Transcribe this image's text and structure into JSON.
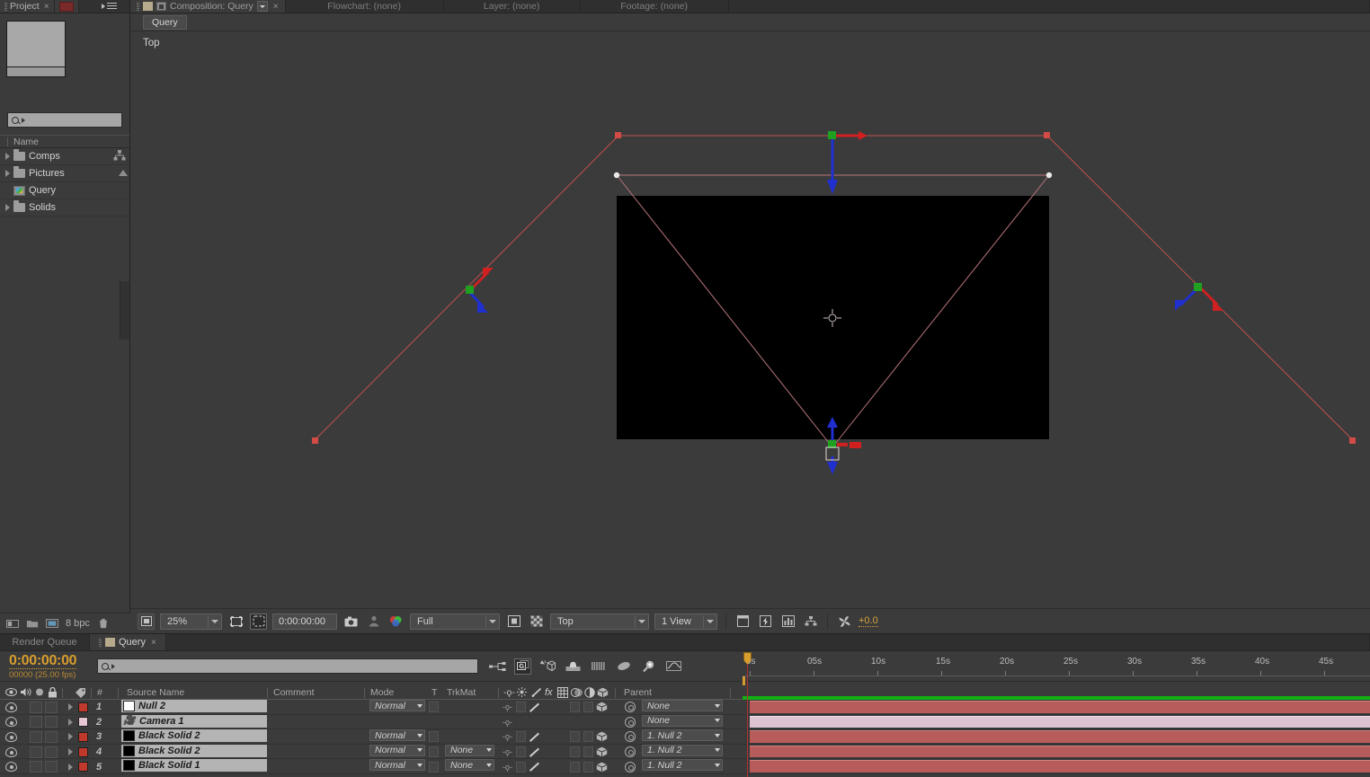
{
  "project": {
    "tab_label": "Project",
    "close_glyph": "×",
    "search_placeholder": "",
    "search_value": "",
    "column_header": "Name",
    "items": [
      {
        "label": "Comps",
        "icon": "folder-icon",
        "has_disclosure": true
      },
      {
        "label": "Pictures",
        "icon": "folder-icon",
        "has_disclosure": true
      },
      {
        "label": "Query",
        "icon": "composition-icon",
        "has_disclosure": false
      },
      {
        "label": "Solids",
        "icon": "folder-icon",
        "has_disclosure": true
      }
    ],
    "footer": {
      "bit_depth": "8 bpc",
      "icons": [
        "new-comp-icon",
        "new-folder-icon",
        "new-footage-icon",
        "delete-icon"
      ]
    }
  },
  "comp_panel": {
    "tabs": [
      {
        "label": "Composition: Query",
        "active": true
      },
      {
        "label": "Flowchart: (none)",
        "active": false
      },
      {
        "label": "Layer: (none)",
        "active": false
      },
      {
        "label": "Footage: (none)",
        "active": false
      }
    ],
    "sub_tab": "Query",
    "view_label": "Top",
    "toolbar": {
      "magnification": "25%",
      "timecode": "0:00:00:00",
      "resolution": "Full",
      "view_layout_3d": "Top",
      "views": "1 View",
      "exposure": "+0.0",
      "icons": [
        "always-preview-icon",
        "region-of-interest-icon",
        "toggle-mask-paths-icon",
        "snapshot-icon",
        "show-snapshot-icon",
        "channel-icon",
        "toggle-transparency-grid-icon",
        "toggle-pixel-aspect-icon",
        "timeline-icon",
        "fast-previews-icon",
        "comp-flowchart-icon",
        "reset-exposure-icon"
      ]
    }
  },
  "timeline": {
    "tabs": [
      {
        "label": "Render Queue",
        "active": false
      },
      {
        "label": "Query",
        "active": true,
        "close_glyph": "×"
      }
    ],
    "current_time": "0:00:00:00",
    "frame_info": "00000 (25.00 fps)",
    "search_value": "",
    "tools": [
      "composition-mini-flowchart-icon",
      "draft-3d-icon",
      "hide-shy-layers-icon",
      "frame-blending-icon",
      "motion-blur-icon",
      "brainstorm-icon",
      "auto-keyframe-icon",
      "graph-editor-icon"
    ],
    "ruler_ticks": [
      "0s",
      "05s",
      "10s",
      "15s",
      "20s",
      "25s",
      "30s",
      "35s",
      "40s",
      "45s"
    ],
    "columns": [
      "Source Name",
      "Comment",
      "Mode",
      "T",
      "TrkMat",
      "Parent"
    ],
    "switch_icons": [
      "video-eye-icon",
      "audio-speaker-icon",
      "solo-icon",
      "lock-icon",
      "label-tag-icon",
      "layer-number-icon"
    ],
    "feature_icons": [
      "shy-icon",
      "collapse-icon",
      "quality-icon",
      "effects-fx-icon",
      "frame-blend-icon",
      "motion-blur-icon",
      "adjustment-icon",
      "3d-layer-icon"
    ],
    "layers": [
      {
        "index": "1",
        "name": "Null 2",
        "label_color": "#c0392b",
        "source_swatch": "#ffffff",
        "source_icon": "solid-swatch-icon",
        "mode": "Normal",
        "trkmat": "",
        "has_trkmat": false,
        "parent": "None",
        "bar_color": "red",
        "is_camera": false
      },
      {
        "index": "2",
        "name": "Camera 1",
        "label_color": "#e8c7d4",
        "source_swatch": "",
        "source_icon": "camera-icon",
        "mode": "",
        "trkmat": "",
        "has_trkmat": false,
        "parent": "None",
        "bar_color": "pink",
        "is_camera": true
      },
      {
        "index": "3",
        "name": "Black Solid 2",
        "label_color": "#c0392b",
        "source_swatch": "#000000",
        "source_icon": "solid-swatch-icon",
        "mode": "Normal",
        "trkmat": "",
        "has_trkmat": false,
        "parent": "1. Null 2",
        "bar_color": "red",
        "is_camera": false
      },
      {
        "index": "4",
        "name": "Black Solid 2",
        "label_color": "#c0392b",
        "source_swatch": "#000000",
        "source_icon": "solid-swatch-icon",
        "mode": "Normal",
        "trkmat": "None",
        "has_trkmat": true,
        "parent": "1. Null 2",
        "bar_color": "red",
        "is_camera": false
      },
      {
        "index": "5",
        "name": "Black Solid 1",
        "label_color": "#c0392b",
        "source_swatch": "#000000",
        "source_icon": "solid-swatch-icon",
        "mode": "Normal",
        "trkmat": "None",
        "has_trkmat": true,
        "parent": "1. Null 2",
        "bar_color": "red",
        "is_camera": false
      }
    ]
  },
  "colors": {
    "accent_orange": "#d79d2e",
    "layer_red": "#b85b5b",
    "camera_pink": "#ddc3cf",
    "work_area_green": "#12b012",
    "wireframe_red": "#c0504d",
    "axis_x": "#d02020",
    "axis_y": "#20a020",
    "axis_z": "#2030d0"
  }
}
